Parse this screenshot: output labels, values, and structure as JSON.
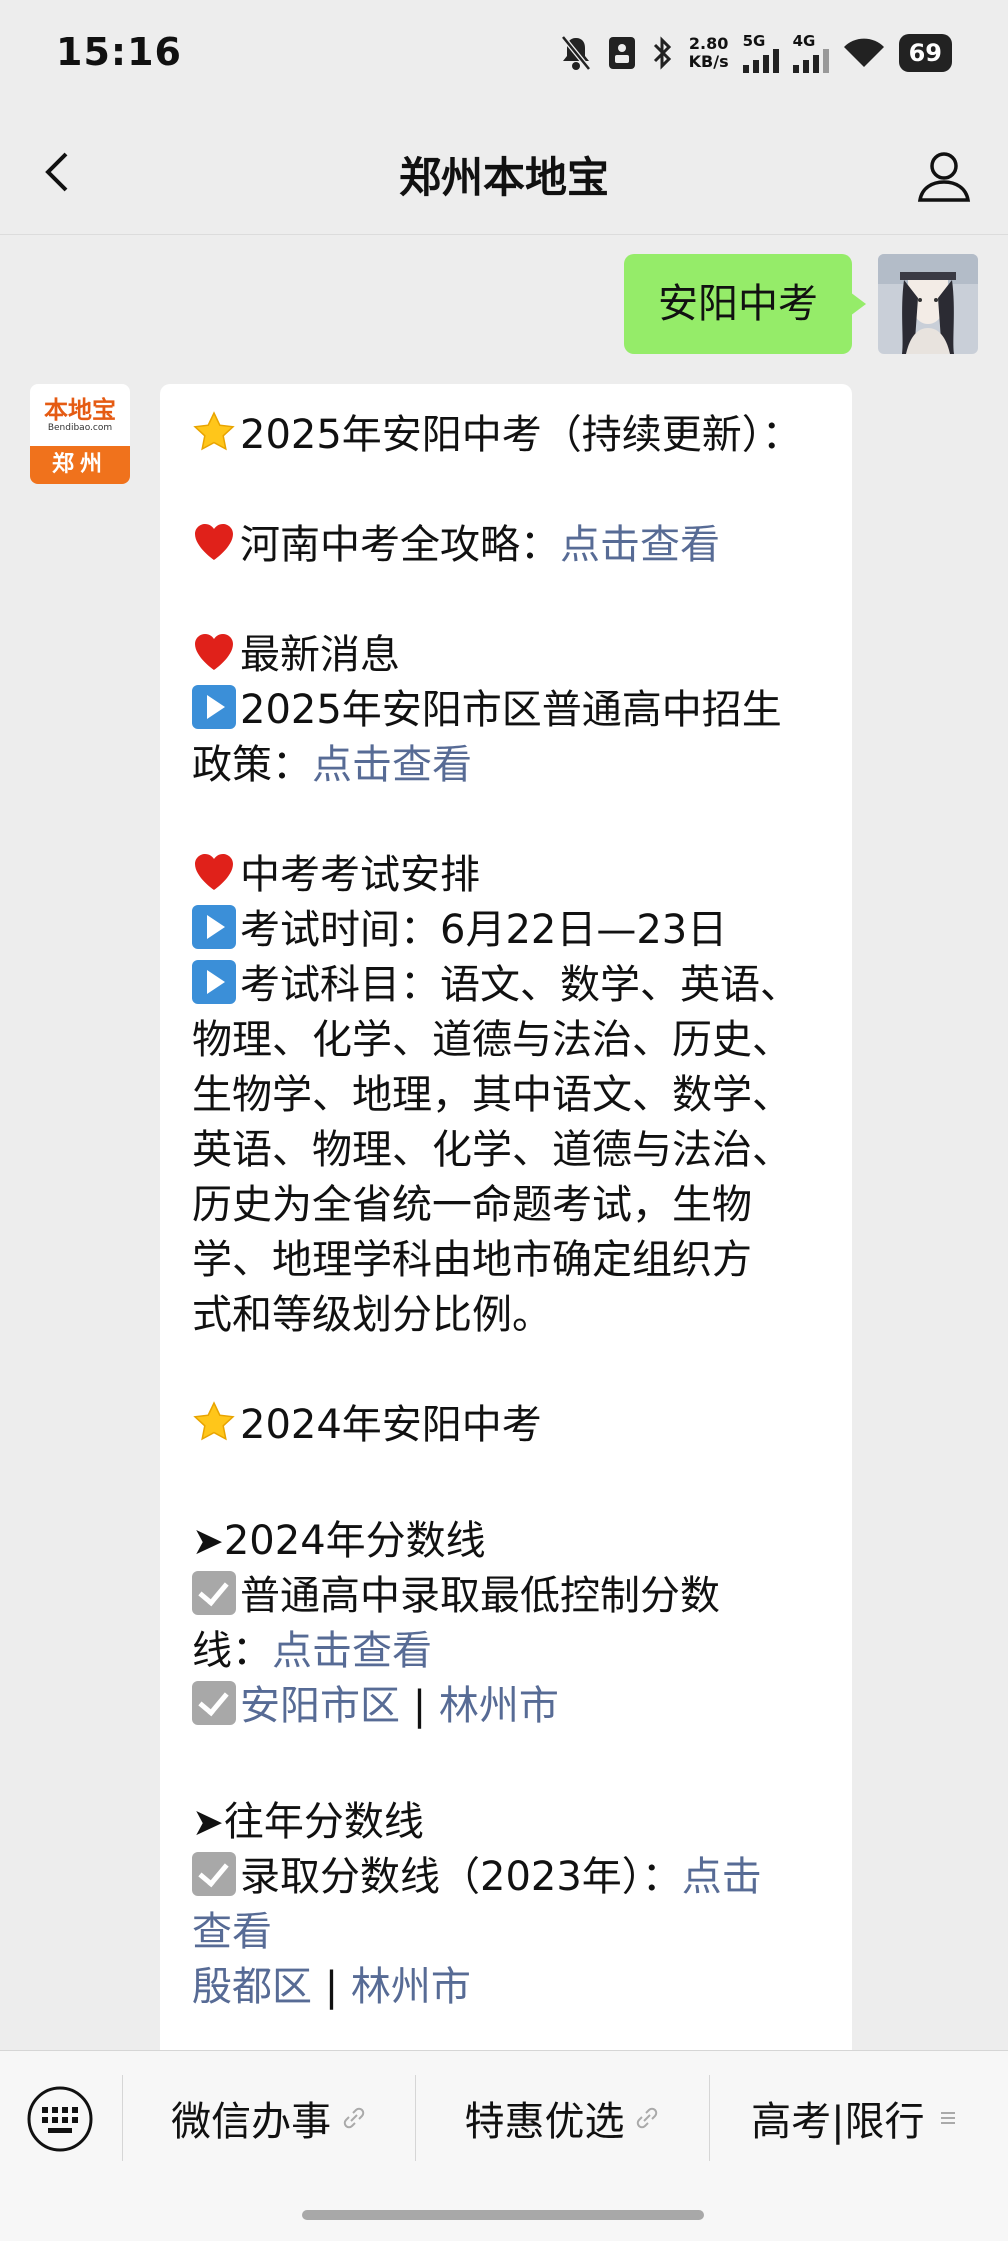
{
  "status": {
    "time": "15:16",
    "net_speed_value": "2.80",
    "net_speed_unit": "KB/s",
    "sig1": "5G",
    "sig2": "4G",
    "battery": "69"
  },
  "nav": {
    "title": "郑州本地宝"
  },
  "sent": {
    "text": "安阳中考"
  },
  "bot": {
    "brand": "本地宝",
    "site": "Bendibao.com",
    "city": "郑州"
  },
  "message": {
    "l1": "2025年安阳中考（持续更新）：",
    "l2_text": "河南中考全攻略：",
    "l2_link": "点击查看",
    "l3": "最新消息",
    "l4": "2025年安阳市区普通高中招生",
    "l5_text": "政策：",
    "l5_link": "点击查看",
    "l6": "中考考试安排",
    "l7": "考试时间：6月22日—23日",
    "l8": "考试科目：语文、数学、英语、",
    "l9": "物理、化学、道德与法治、历史、",
    "l10": "生物学、地理，其中语文、数学、",
    "l11": "英语、物理、化学、道德与法治、",
    "l12": "历史为全省统一命题考试，生物",
    "l13": "学、地理学科由地市确定组织方",
    "l14": "式和等级划分比例。",
    "l15": "2024年安阳中考",
    "l16": "2024年分数线",
    "l17": "普通高中录取最低控制分数",
    "l18_text": "线：",
    "l18_link": "点击查看",
    "l19_link1": "安阳市区",
    "sep": " | ",
    "l19_link2": "林州市",
    "l20": "往年分数线",
    "l21_text": "录取分数线（2023年）：",
    "l21_link": "点击",
    "l22_link": "查看",
    "l23_link1": "殷都区",
    "l23_link2": "林州市"
  },
  "menu": {
    "item1": "微信办事",
    "item2": "特惠优选",
    "item3": "高考|限行"
  }
}
